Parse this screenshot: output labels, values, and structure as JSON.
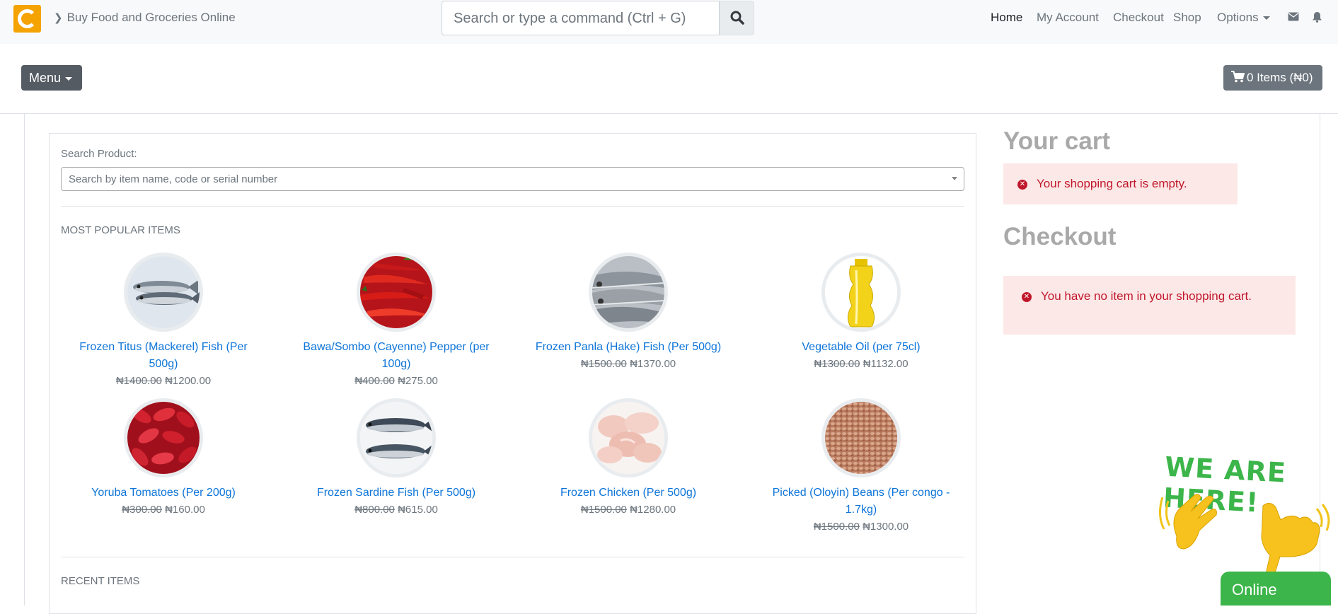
{
  "header": {
    "breadcrumb": "Buy Food and Groceries Online",
    "search_placeholder": "Search or type a command (Ctrl + G)",
    "nav": [
      "Home",
      "My Account",
      "Checkout",
      "Shop",
      "Options"
    ]
  },
  "toolbar": {
    "menu_label": "Menu",
    "cart_label": "0 Items (₦0)"
  },
  "search_product": {
    "label": "Search Product:",
    "placeholder": "Search by item name, code or serial number"
  },
  "sections": {
    "popular": "MOST POPULAR ITEMS",
    "recent": "RECENT ITEMS"
  },
  "products": [
    {
      "name": "Frozen Titus (Mackerel) Fish (Per 500g)",
      "old_price": "₦1400.00",
      "price": "₦1200.00"
    },
    {
      "name": "Bawa/Sombo (Cayenne) Pepper (per 100g)",
      "old_price": "₦400.00",
      "price": "₦275.00"
    },
    {
      "name": "Frozen Panla (Hake) Fish (Per 500g)",
      "old_price": "₦1500.00",
      "price": "₦1370.00"
    },
    {
      "name": "Vegetable Oil (per 75cl)",
      "old_price": "₦1300.00",
      "price": "₦1132.00"
    },
    {
      "name": "Yoruba Tomatoes (Per 200g)",
      "old_price": "₦300.00",
      "price": "₦160.00"
    },
    {
      "name": "Frozen Sardine Fish (Per 500g)",
      "old_price": "₦800.00",
      "price": "₦615.00"
    },
    {
      "name": "Frozen Chicken (Per 500g)",
      "old_price": "₦1500.00",
      "price": "₦1280.00"
    },
    {
      "name": "Picked (Oloyin) Beans (Per congo - 1.7kg)",
      "old_price": "₦1500.00",
      "price": "₦1300.00"
    }
  ],
  "sidebar": {
    "cart_title": "Your cart",
    "cart_message": "Your shopping cart is empty.",
    "checkout_title": "Checkout",
    "checkout_message": "You have no item in your shopping cart."
  },
  "widget": {
    "banner": "WE ARE HERE!",
    "status": "Online"
  },
  "colors": {
    "link": "#0d74d8",
    "alert_bg": "#fde8e8",
    "alert_text": "#c0172a",
    "online_green": "#3cb54a",
    "logo": "#f5a300"
  }
}
